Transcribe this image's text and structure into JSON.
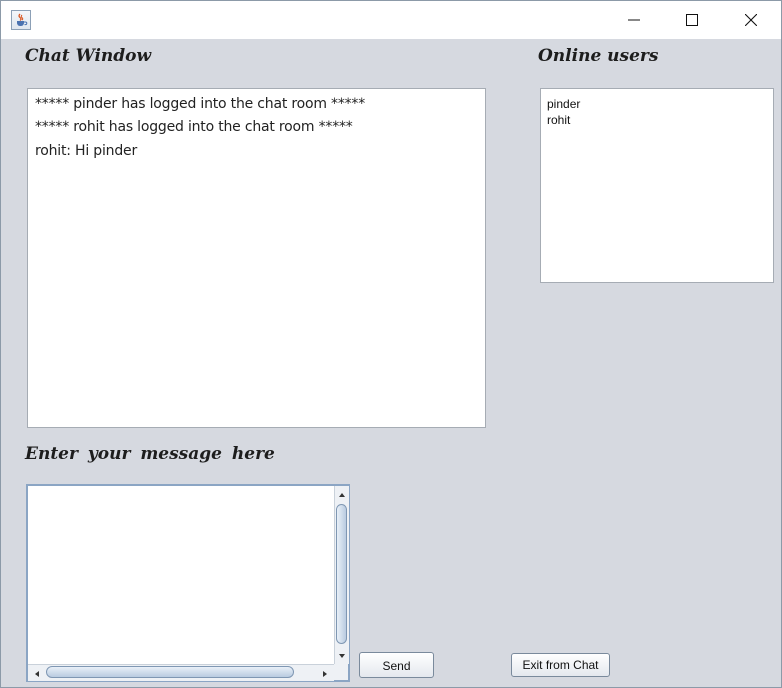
{
  "window": {
    "title": "",
    "icons": {
      "app": "java-cup-icon",
      "minimize": "minimize-icon",
      "maximize": "maximize-icon",
      "close": "close-icon"
    }
  },
  "chat": {
    "heading": "Chat Window",
    "lines": [
      "***** pinder has logged into the chat room *****",
      "***** rohit has logged into the chat room *****",
      "rohit: Hi pinder"
    ]
  },
  "online": {
    "heading": "Online users",
    "users": [
      "pinder",
      "rohit"
    ]
  },
  "message": {
    "heading": "Enter  your  message  here",
    "value": ""
  },
  "buttons": {
    "send": "Send",
    "exit": "Exit from Chat"
  },
  "colors": {
    "background": "#d6d9e0",
    "panel": "#ffffff",
    "scroll_accent": "#8ba5c4"
  }
}
